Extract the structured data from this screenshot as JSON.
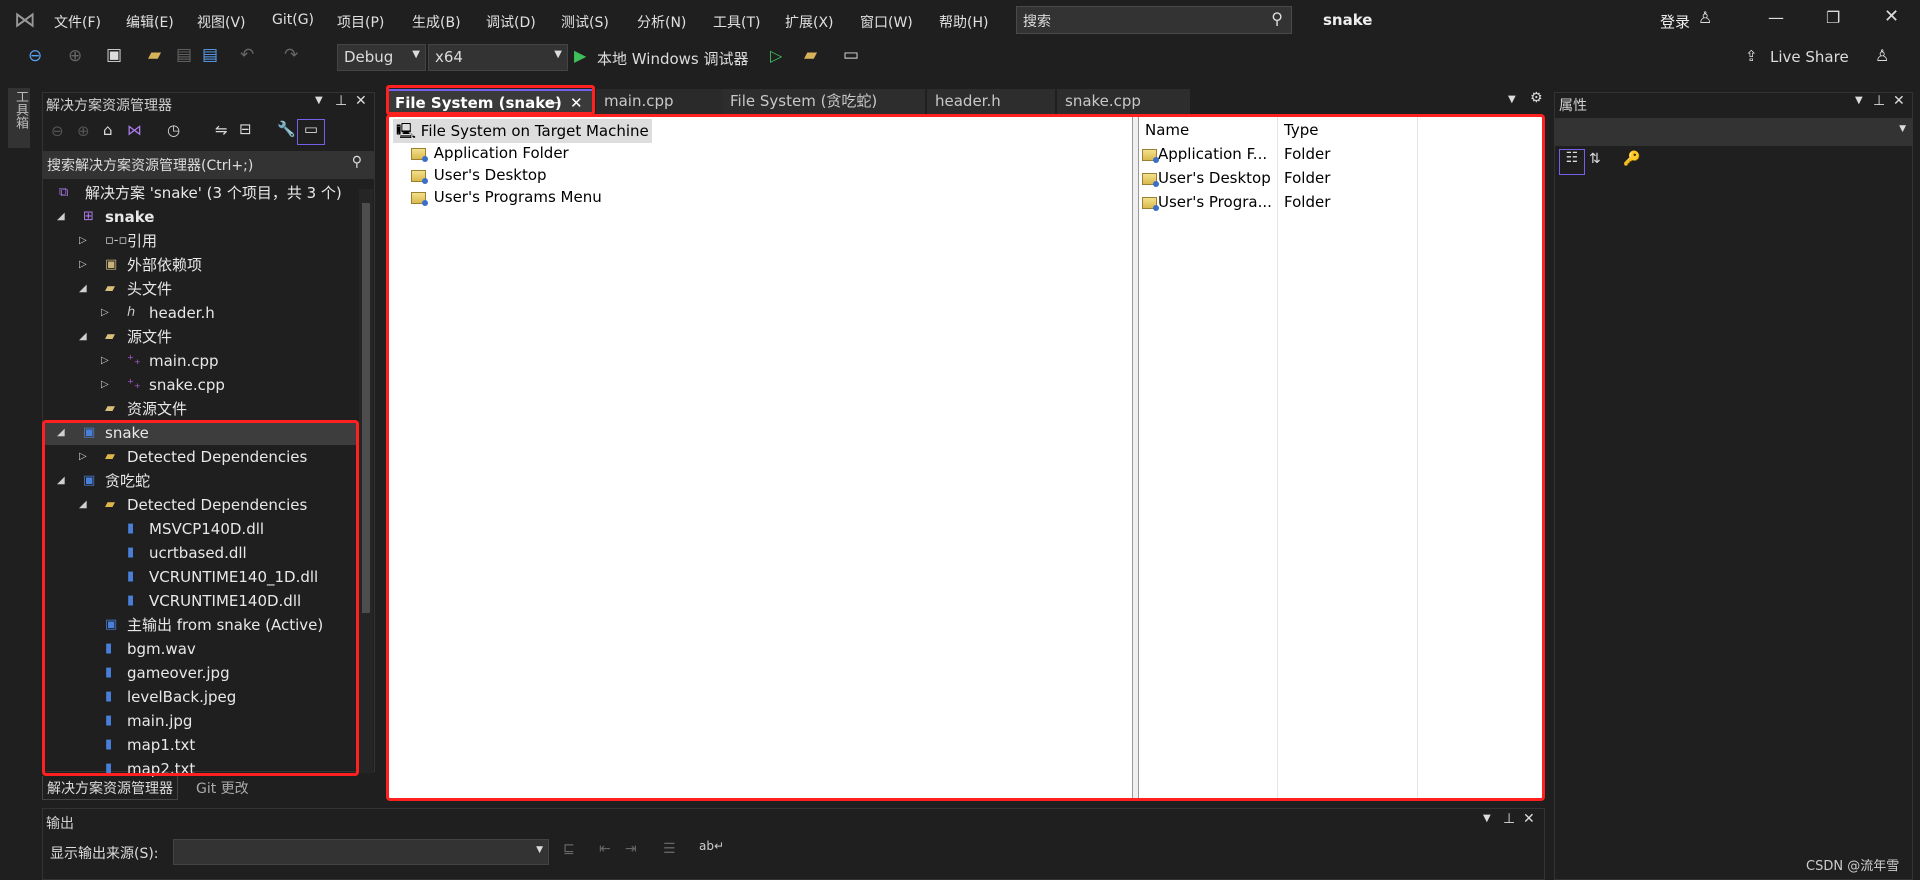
{
  "titlebar": {
    "menu": [
      "文件(F)",
      "编辑(E)",
      "视图(V)",
      "Git(G)",
      "项目(P)",
      "生成(B)",
      "调试(D)",
      "测试(S)",
      "分析(N)",
      "工具(T)",
      "扩展(X)",
      "窗口(W)",
      "帮助(H)"
    ],
    "search_placeholder": "搜索",
    "solution_name": "snake",
    "login": "登录"
  },
  "toolbar": {
    "config": "Debug",
    "platform": "x64",
    "run_label": "本地 Windows 调试器",
    "live_share": "Live Share"
  },
  "toolbox_strip": "工具箱",
  "solution_explorer": {
    "title": "解决方案资源管理器",
    "search_placeholder": "搜索解决方案资源管理器(Ctrl+;)",
    "items": [
      {
        "label": "解决方案 'snake' (3 个项目，共 3 个)",
        "level": 0,
        "expander": "none",
        "icon": "solution-icon"
      },
      {
        "label": "snake",
        "level": 1,
        "expander": "expanded",
        "icon": "cpp-project-icon",
        "bold": true
      },
      {
        "label": "引用",
        "level": 2,
        "expander": "collapsed",
        "icon": "references-icon"
      },
      {
        "label": "外部依赖项",
        "level": 2,
        "expander": "collapsed",
        "icon": "external-deps-icon"
      },
      {
        "label": "头文件",
        "level": 2,
        "expander": "expanded",
        "icon": "filter-folder-icon"
      },
      {
        "label": "header.h",
        "level": 3,
        "expander": "collapsed",
        "icon": "header-file-icon"
      },
      {
        "label": "源文件",
        "level": 2,
        "expander": "expanded",
        "icon": "filter-folder-icon"
      },
      {
        "label": "main.cpp",
        "level": 3,
        "expander": "collapsed",
        "icon": "cpp-file-icon"
      },
      {
        "label": "snake.cpp",
        "level": 3,
        "expander": "collapsed",
        "icon": "cpp-file-icon"
      },
      {
        "label": "资源文件",
        "level": 2,
        "expander": "none",
        "icon": "filter-folder-icon"
      },
      {
        "label": "snake",
        "level": 1,
        "expander": "expanded",
        "icon": "setup-project-icon",
        "selected": true
      },
      {
        "label": "Detected Dependencies",
        "level": 2,
        "expander": "collapsed",
        "icon": "folder-icon"
      },
      {
        "label": "贪吃蛇",
        "level": 1,
        "expander": "expanded",
        "icon": "setup-project-icon"
      },
      {
        "label": "Detected Dependencies",
        "level": 2,
        "expander": "expanded",
        "icon": "folder-open-icon"
      },
      {
        "label": "MSVCP140D.dll",
        "level": 3,
        "expander": "none",
        "icon": "file-icon"
      },
      {
        "label": "ucrtbased.dll",
        "level": 3,
        "expander": "none",
        "icon": "file-icon"
      },
      {
        "label": "VCRUNTIME140_1D.dll",
        "level": 3,
        "expander": "none",
        "icon": "file-icon"
      },
      {
        "label": "VCRUNTIME140D.dll",
        "level": 3,
        "expander": "none",
        "icon": "file-icon"
      },
      {
        "label": "主输出 from snake (Active)",
        "level": 2,
        "expander": "none",
        "icon": "primary-output-icon"
      },
      {
        "label": "bgm.wav",
        "level": 2,
        "expander": "none",
        "icon": "file-icon"
      },
      {
        "label": "gameover.jpg",
        "level": 2,
        "expander": "none",
        "icon": "file-icon"
      },
      {
        "label": "levelBack.jpeg",
        "level": 2,
        "expander": "none",
        "icon": "file-icon"
      },
      {
        "label": "main.jpg",
        "level": 2,
        "expander": "none",
        "icon": "file-icon"
      },
      {
        "label": "map1.txt",
        "level": 2,
        "expander": "none",
        "icon": "file-icon"
      },
      {
        "label": "map2.txt",
        "level": 2,
        "expander": "none",
        "icon": "file-icon"
      }
    ],
    "bottom_tabs": [
      "解决方案资源管理器",
      "Git 更改"
    ]
  },
  "doc_tabs": [
    "File System (snake)",
    "main.cpp",
    "File System (贪吃蛇)",
    "header.h",
    "snake.cpp"
  ],
  "filesystem": {
    "root": "File System on Target Machine",
    "folders": [
      "Application Folder",
      "User's Desktop",
      "User's Programs Menu"
    ],
    "columns": [
      "Name",
      "Type"
    ],
    "rows": [
      [
        "Application F...",
        "Folder"
      ],
      [
        "User's Desktop",
        "Folder"
      ],
      [
        "User's Progra...",
        "Folder"
      ]
    ]
  },
  "properties": {
    "title": "属性"
  },
  "output": {
    "title": "输出",
    "source_label": "显示输出来源(S):"
  },
  "watermark": "CSDN @流年雪",
  "colors": {
    "accent": "#7160e8",
    "highlight": "#ff0000"
  }
}
